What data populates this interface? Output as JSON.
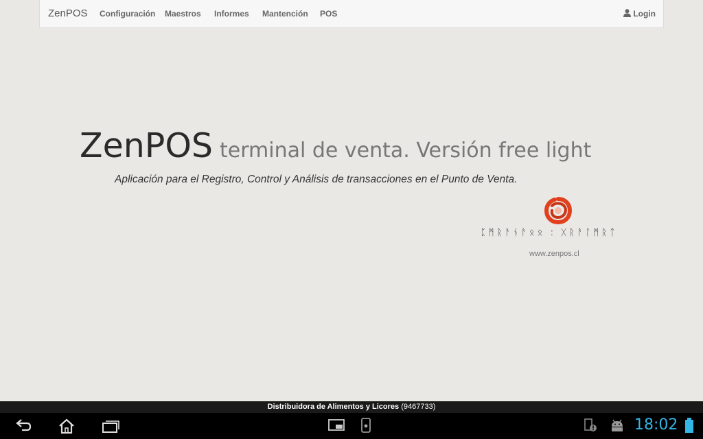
{
  "navbar": {
    "brand": "ZenPOS",
    "items": [
      "Configuración",
      "Maestros",
      "Informes",
      "Mantención",
      "POS"
    ],
    "login_label": "Login",
    "login_icon": "user-icon"
  },
  "hero": {
    "title": "ZenPOS",
    "subtitle": "terminal de venta. Versión free light",
    "tagline": "Aplicación para el Registro, Control y Análisis de transacciones en el Punto de Venta.",
    "logo_color": "#e2401c",
    "runes_text": "ᛈᛗᚱᚨᚾᚨᛟᛟ : ᚷᚱᚨᛚᛗᚱᛏ",
    "url": "www.zenpos.cl"
  },
  "status_strip": {
    "company": "Distribuidora de Alimentos y Licores",
    "code": "(9467733)"
  },
  "system_bar": {
    "icons": [
      "back-icon",
      "home-icon",
      "recent-apps-icon",
      "screenshot-icon",
      "phone-icon",
      "notification-icon",
      "android-icon",
      "battery-icon"
    ],
    "clock": "18:02",
    "accent": "#33b5e5"
  }
}
